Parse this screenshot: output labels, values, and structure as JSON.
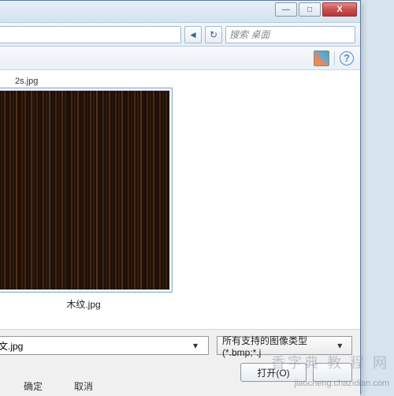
{
  "titlebar": {
    "close_glyph": "X"
  },
  "address": {
    "back_glyph": "◄",
    "refresh_glyph": "↻",
    "search_placeholder": "搜索 桌面"
  },
  "toolbar": {
    "help_glyph": "?"
  },
  "files": {
    "prev_item": "2s.jpg",
    "selected_label": "木纹.jpg"
  },
  "bottom": {
    "filename_value": "文.jpg",
    "filter_value": "所有支持的图像类型 (*.bmp;*.j",
    "open_label": "打开(O)",
    "dropdown_glyph": "▾"
  },
  "under": {
    "ok_label": "确定",
    "cancel_label": "取消"
  },
  "watermark": {
    "big": "香字典 教 程 网",
    "small": "jiaocheng.chazidian.com"
  }
}
